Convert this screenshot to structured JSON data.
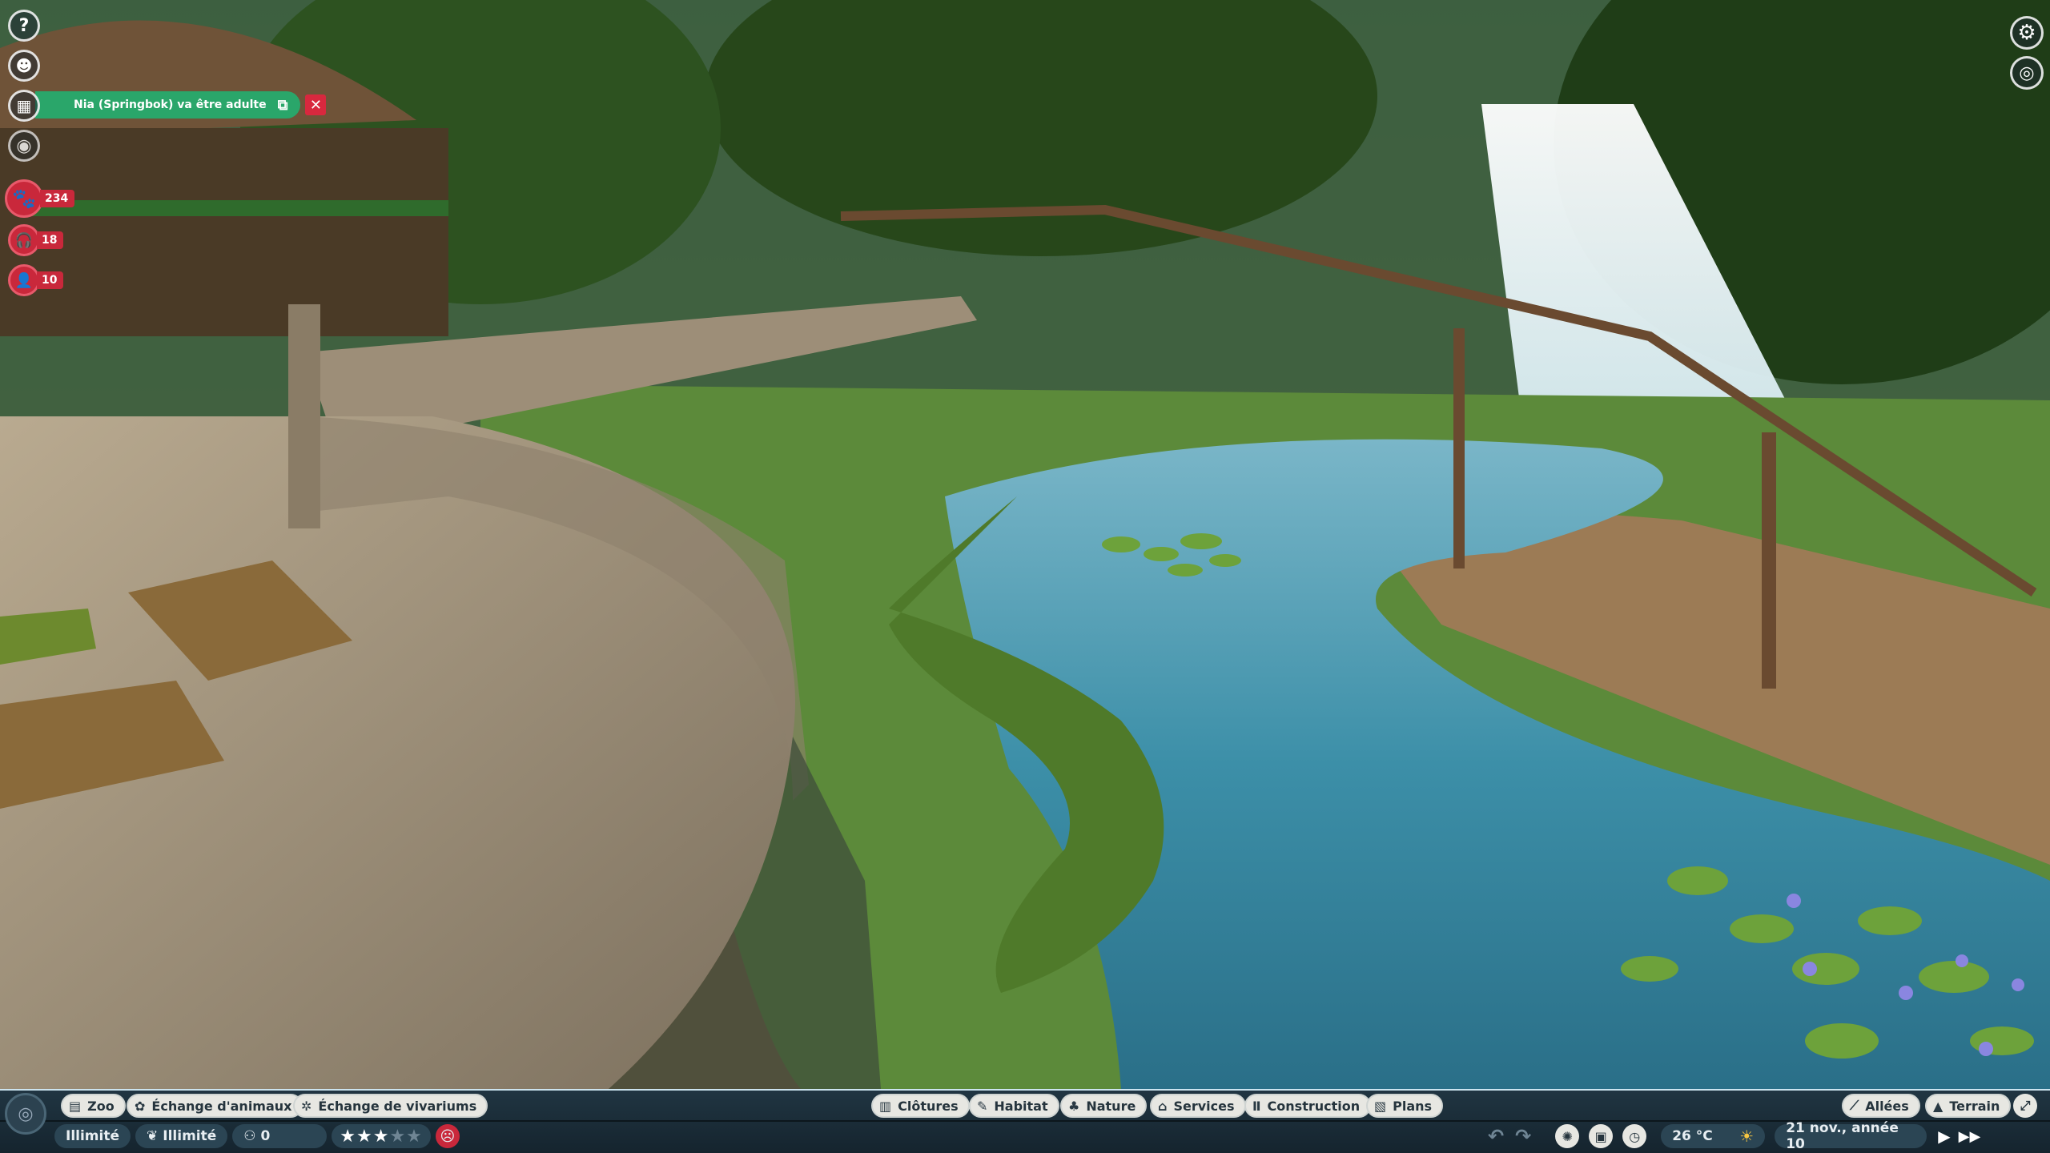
{
  "notification": {
    "text": "Nia (Springbok) va être adulte",
    "open_icon": "external-link-icon",
    "close_icon": "close-icon"
  },
  "left_menu": [
    {
      "name": "help-icon",
      "glyph": "?"
    },
    {
      "name": "zookeeper-icon",
      "glyph": "☻"
    },
    {
      "name": "calendar-icon",
      "glyph": "▦"
    },
    {
      "name": "view-icon",
      "glyph": "◉"
    }
  ],
  "stats": {
    "animals": "234",
    "staff": "18",
    "guests": "10"
  },
  "bottom_tabs_left": [
    {
      "key": "zoo",
      "label": "Zoo",
      "icon": "zoo-icon"
    },
    {
      "key": "animal_trade",
      "label": "Échange d'animaux",
      "icon": "paw-icon"
    },
    {
      "key": "vivarium_trade",
      "label": "Échange de vivariums",
      "icon": "bug-icon"
    }
  ],
  "bottom_tabs_center": [
    {
      "key": "fences",
      "label": "Clôtures",
      "icon": "fence-icon"
    },
    {
      "key": "habitat",
      "label": "Habitat",
      "icon": "habitat-icon"
    },
    {
      "key": "nature",
      "label": "Nature",
      "icon": "tree-icon"
    },
    {
      "key": "services",
      "label": "Services",
      "icon": "building-icon"
    },
    {
      "key": "construction",
      "label": "Construction",
      "icon": "pillar-icon"
    },
    {
      "key": "plans",
      "label": "Plans",
      "icon": "blueprint-icon"
    }
  ],
  "bottom_tabs_right": [
    {
      "key": "paths",
      "label": "Allées",
      "icon": "path-icon"
    },
    {
      "key": "terrain",
      "label": "Terrain",
      "icon": "mountain-icon"
    }
  ],
  "status": {
    "money": "Illimité",
    "research": "Illimité",
    "guests_count": "0",
    "rating_stars": 3,
    "rating_max": 5,
    "temperature": "26 °C",
    "weather_icon": "sun-icon",
    "date": "21 nov., année 10"
  },
  "colors": {
    "bar_bg": "#1b2d38",
    "pill_bg": "#e7e7e2",
    "notif_green": "#2aa66a",
    "stat_red": "#c9283b"
  }
}
